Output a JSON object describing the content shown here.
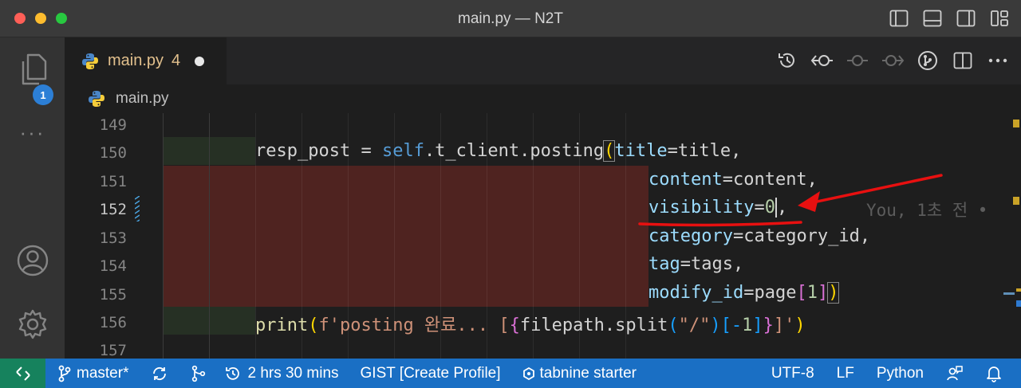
{
  "window": {
    "title": "main.py — N2T"
  },
  "activity_bar": {
    "explorer_badge": "1",
    "more_label": "···"
  },
  "tab": {
    "label": "main.py",
    "problem_count": "4"
  },
  "breadcrumb": {
    "file": "main.py"
  },
  "code": {
    "line_numbers": [
      "149",
      "150",
      "151",
      "152",
      "153",
      "154",
      "155",
      "156",
      "157"
    ],
    "active_line": "152",
    "blame": "You, 1초 전 •",
    "tokens": {
      "l150_var": "resp_post = ",
      "l150_self": "self",
      "l150_call": ".t_client.posting",
      "l150_paren": "(",
      "l150_p": "title",
      "l150_rest": "=title,",
      "l151_p": "content",
      "l151_rest": "=content,",
      "l152_p": "visibility",
      "l152_eq": "=",
      "l152_num": "0",
      "l152_comma": ",",
      "l153_p": "category",
      "l153_rest": "=category_id,",
      "l154_p": "tag",
      "l154_rest": "=tags,",
      "l155_p": "modify_id",
      "l155_mid": "=page",
      "l155_lb": "[",
      "l155_num": "1",
      "l155_rb": "]",
      "l155_close": ")",
      "l156_fn": "print",
      "l156_lp": "(",
      "l156_str1": "f'posting 완료... [",
      "l156_lc": "{",
      "l156_expr": "filepath.split",
      "l156_lp2": "(",
      "l156_str2": "\"/\"",
      "l156_rp2": ")",
      "l156_idx1": "[-",
      "l156_num": "1",
      "l156_idx2": "]",
      "l156_rc": "}",
      "l156_str3": "]'",
      "l156_rp": ")"
    }
  },
  "status_bar": {
    "branch": "master*",
    "time": "2 hrs 30 mins",
    "gist": "GIST [Create Profile]",
    "tabnine": "tabnine starter",
    "encoding": "UTF-8",
    "eol": "LF",
    "language": "Python"
  },
  "colors": {
    "accent": "#1a6fc4",
    "remote": "#16825d",
    "deleted_bg": "#4f2320",
    "annotation": "#e81010"
  }
}
